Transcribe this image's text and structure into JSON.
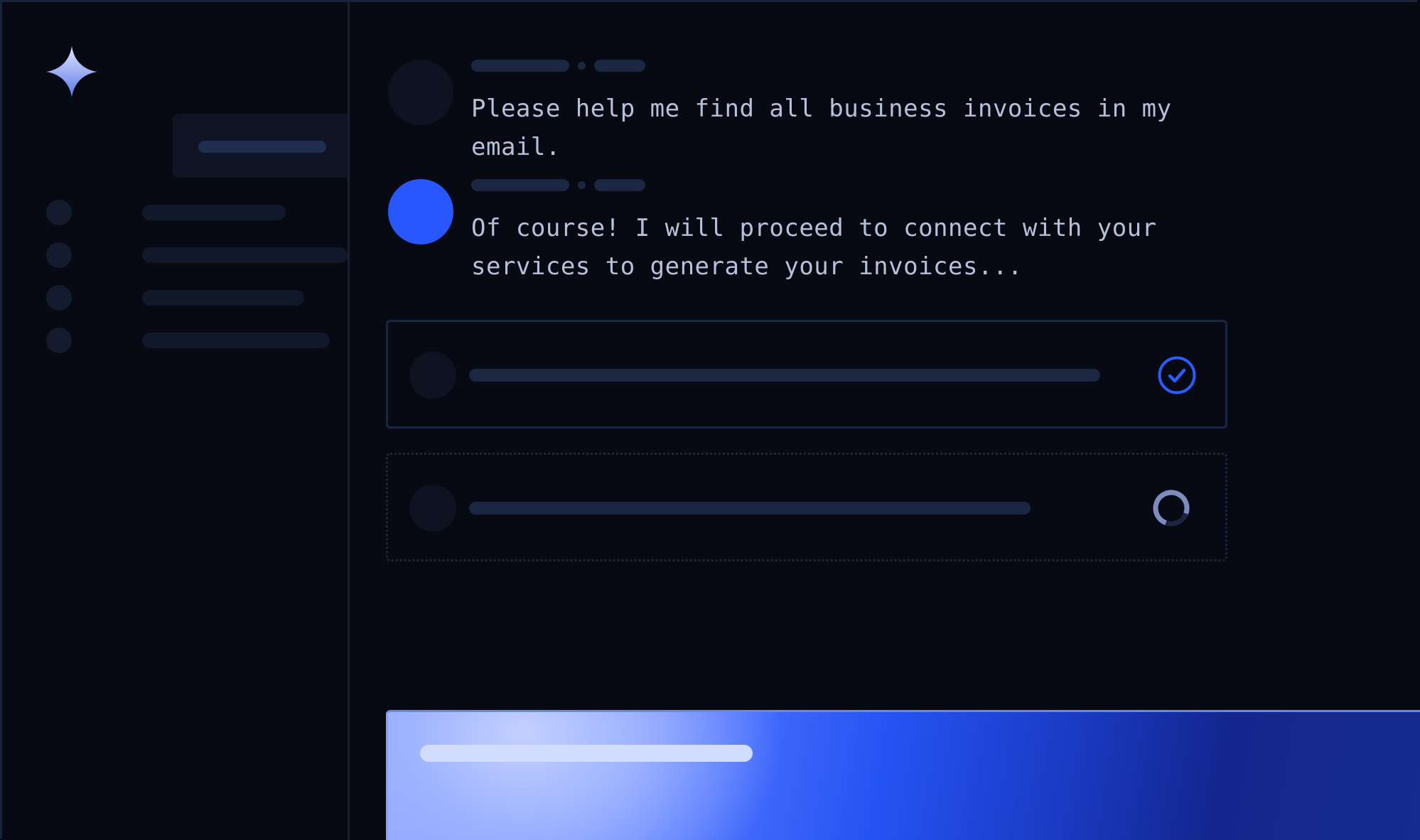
{
  "sidebar": {
    "logo_icon": "sparkle-icon",
    "nav_items": 4
  },
  "conversation": {
    "user_message": "Please help me find all business invoices in my email.",
    "assistant_message": "Of course! I will proceed to connect with your services to generate your invoices..."
  },
  "tasks": [
    {
      "status": "completed",
      "icon": "check-circle-icon"
    },
    {
      "status": "in-progress",
      "icon": "spinner-icon"
    }
  ],
  "colors": {
    "background": "#070a13",
    "accent": "#2957ff",
    "text": "#b7c0da",
    "placeholder": "#1b2641"
  }
}
